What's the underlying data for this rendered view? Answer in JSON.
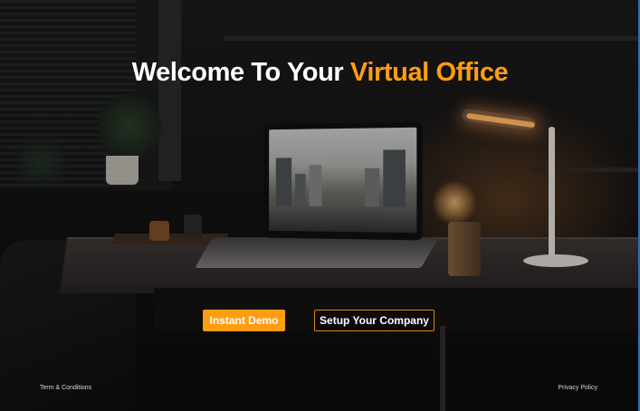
{
  "hero": {
    "title_prefix": "Welcome To Your ",
    "title_highlight": "Virtual Office"
  },
  "actions": {
    "instant_demo": "Instant Demo",
    "setup_company": "Setup Your Company"
  },
  "footer": {
    "terms": "Term & Conditions",
    "privacy": "Privacy Policy"
  },
  "colors": {
    "accent": "#ff9d12",
    "text": "#ffffff",
    "background": "#141212"
  }
}
